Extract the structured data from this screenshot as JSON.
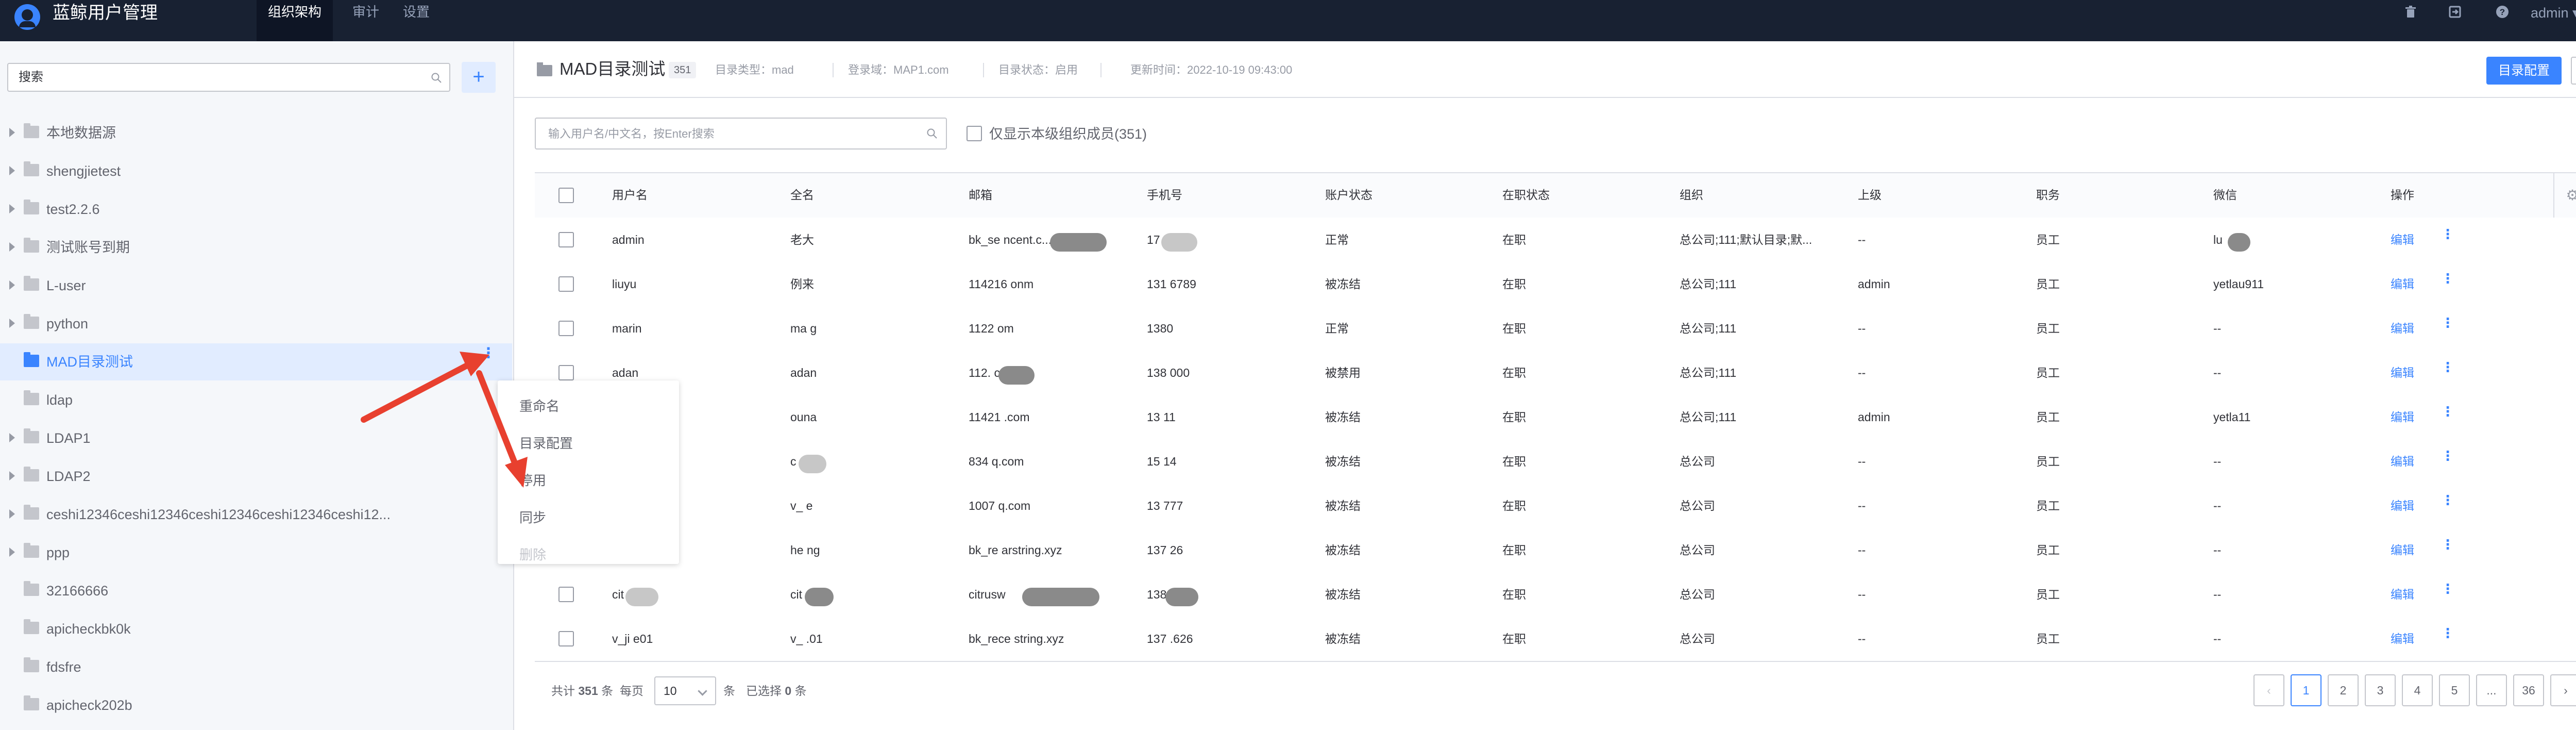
{
  "header": {
    "app_title": "蓝鲸用户管理",
    "nav": [
      "组织架构",
      "审计",
      "设置"
    ],
    "user": "admin",
    "icons": [
      "trash-icon",
      "export-icon",
      "help-icon"
    ]
  },
  "sidebar": {
    "search_placeholder": "搜索",
    "add_label": "+",
    "items": [
      {
        "label": "本地数据源",
        "expandable": true
      },
      {
        "label": "shengjietest",
        "expandable": true
      },
      {
        "label": "test2.2.6",
        "expandable": true
      },
      {
        "label": "测试账号到期",
        "expandable": true
      },
      {
        "label": "L-user",
        "expandable": true
      },
      {
        "label": "python",
        "expandable": true
      },
      {
        "label": "MAD目录测试",
        "expandable": false,
        "active": true
      },
      {
        "label": "ldap",
        "expandable": false
      },
      {
        "label": "LDAP1",
        "expandable": true
      },
      {
        "label": "LDAP2",
        "expandable": true
      },
      {
        "label": "ceshi12346ceshi12346ceshi12346ceshi12346ceshi12...",
        "expandable": true
      },
      {
        "label": "ppp",
        "expandable": true
      },
      {
        "label": "32166666",
        "expandable": false
      },
      {
        "label": "apicheckbk0k",
        "expandable": false
      },
      {
        "label": "fdsfre",
        "expandable": false
      },
      {
        "label": "apicheck202b",
        "expandable": false
      }
    ]
  },
  "context_menu": {
    "items": [
      {
        "label": "重命名",
        "disabled": false
      },
      {
        "label": "目录配置",
        "disabled": false
      },
      {
        "label": "停用",
        "disabled": false
      },
      {
        "label": "同步",
        "disabled": false
      },
      {
        "label": "删除",
        "disabled": true
      }
    ]
  },
  "main": {
    "title": "MAD目录测试",
    "count": "351",
    "meta_type": "目录类型：mad",
    "meta_domain": "登录域：MAP1.com",
    "meta_status": "目录状态：启用",
    "meta_updated": "更新时间：2022-10-19 09:43:00",
    "config_button": "目录配置",
    "search_placeholder": "输入用户名/中文名，按Enter搜索",
    "only_current_label": "仅显示本级组织成员(351)"
  },
  "table": {
    "columns": [
      "用户名",
      "全名",
      "邮箱",
      "手机号",
      "账户状态",
      "在职状态",
      "组织",
      "上级",
      "职务",
      "微信",
      "操作"
    ],
    "rows": [
      {
        "username": "admin",
        "fullname": "老大",
        "email": "bk_se          ncent.c...",
        "phone": "17       7899",
        "status": "正常",
        "job": "在职",
        "org": "总公司;111;默认目录;默...",
        "leader": "--",
        "title": "员工",
        "wechat": "lu",
        "action": "编辑"
      },
      {
        "username": "liuyu",
        "fullname": "例来",
        "email": "114216              onm",
        "phone": "131      6789",
        "status": "被冻结",
        "job": "在职",
        "org": "总公司;111",
        "leader": "admin",
        "title": "员工",
        "wechat": "yetlau911",
        "action": "编辑"
      },
      {
        "username": "marin",
        "fullname": "ma        g",
        "email": "1122             om",
        "phone": "1380",
        "status": "正常",
        "job": "在职",
        "org": "总公司;111",
        "leader": "--",
        "title": "员工",
        "wechat": "--",
        "action": "编辑"
      },
      {
        "username": "adan",
        "fullname": "adan",
        "email": "112.         com",
        "phone": "138       000",
        "status": "被禁用",
        "job": "在职",
        "org": "总公司;111",
        "leader": "--",
        "title": "员工",
        "wechat": "--",
        "action": "编辑"
      },
      {
        "username": "",
        "fullname": "ouna",
        "email": "11421           .com",
        "phone": "13        11",
        "status": "被冻结",
        "job": "在职",
        "org": "总公司;111",
        "leader": "admin",
        "title": "员工",
        "wechat": "yetla11",
        "action": "编辑"
      },
      {
        "username": "",
        "fullname": "c",
        "email": "834              q.com",
        "phone": "15        14",
        "status": "被冻结",
        "job": "在职",
        "org": "总公司",
        "leader": "--",
        "title": "员工",
        "wechat": "--",
        "action": "编辑"
      },
      {
        "username": "",
        "fullname": "v_      e",
        "email": "1007         q.com",
        "phone": "13        777",
        "status": "被冻结",
        "job": "在职",
        "org": "总公司",
        "leader": "--",
        "title": "员工",
        "wechat": "--",
        "action": "编辑"
      },
      {
        "username": "",
        "fullname": "he      ng",
        "email": "bk_re         arstring.xyz",
        "phone": "137       26",
        "status": "被冻结",
        "job": "在职",
        "org": "总公司",
        "leader": "--",
        "title": "员工",
        "wechat": "--",
        "action": "编辑"
      },
      {
        "username": "cit        ng",
        "fullname": "cit        .g",
        "email": "citrusw              ",
        "phone": "138       000",
        "status": "被冻结",
        "job": "在职",
        "org": "总公司",
        "leader": "--",
        "title": "员工",
        "wechat": "--",
        "action": "编辑"
      },
      {
        "username": "v_ji      e01",
        "fullname": "v_       .01",
        "email": "bk_rece         string.xyz",
        "phone": "137      .626",
        "status": "被冻结",
        "job": "在职",
        "org": "总公司",
        "leader": "--",
        "title": "员工",
        "wechat": "--",
        "action": "编辑"
      }
    ]
  },
  "pagination": {
    "total_prefix": "共计",
    "total": "351",
    "total_suffix": "条",
    "per_page_label": "每页",
    "page_size": "10",
    "after_select": "条",
    "selected_text": "已选择",
    "selected_count": "0",
    "selected_suffix": "条",
    "pages": [
      "1",
      "2",
      "3",
      "4",
      "5",
      "...",
      "36"
    ],
    "current": "1"
  },
  "colors": {
    "header_bg": "#182132",
    "primary": "#3a84ff",
    "annotation_arrow": "#e8402f"
  }
}
